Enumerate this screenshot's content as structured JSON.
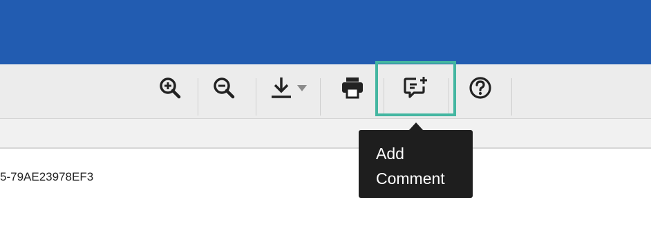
{
  "colors": {
    "header": "#225cb1",
    "toolbar": "#ececec",
    "highlight": "#44b6a1",
    "tooltip_bg": "#1e1e1e"
  },
  "toolbar": {
    "buttons": [
      {
        "icon": "zoom-in-icon"
      },
      {
        "icon": "zoom-out-icon"
      },
      {
        "icon": "download-icon"
      },
      {
        "icon": "print-icon"
      },
      {
        "icon": "add-comment-icon"
      },
      {
        "icon": "help-icon"
      }
    ]
  },
  "content": {
    "document_id": "5-79AE23978EF3"
  },
  "tooltip": {
    "line1": "Add",
    "line2": "Comment"
  }
}
